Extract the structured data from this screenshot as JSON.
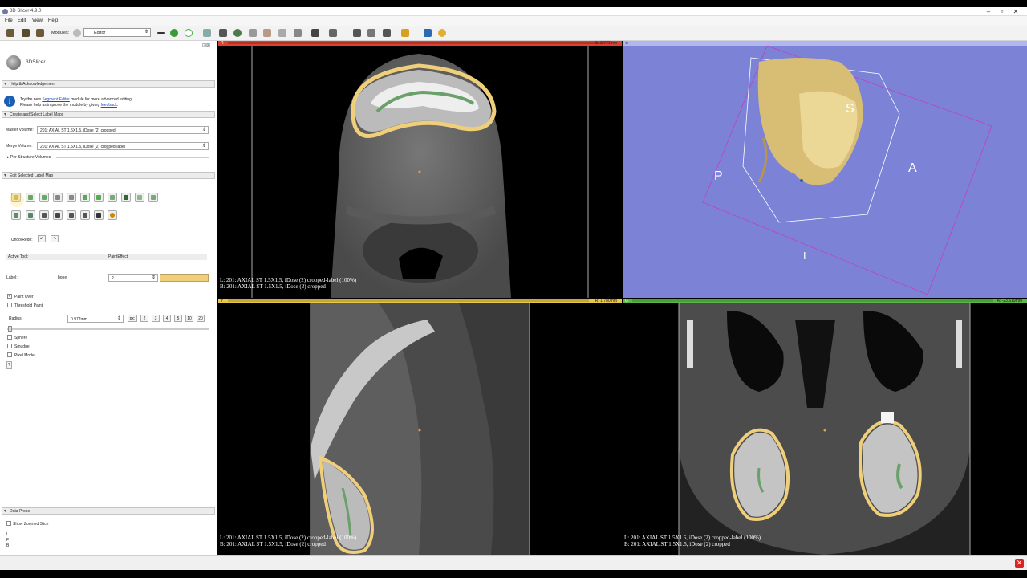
{
  "window": {
    "title": "3D Slicer 4.9.0"
  },
  "menu": [
    "File",
    "Edit",
    "View",
    "Help"
  ],
  "toolbar": {
    "modules_label": "Modules:",
    "module_selected": "Editor"
  },
  "logo": {
    "text": "3DSlicer"
  },
  "sections": {
    "help": "Help & Acknowledgement",
    "create_select": "Create and Select Label Maps",
    "edit_selected": "Edit Selected Label Map",
    "data_probe": "Data Probe"
  },
  "info": {
    "line1_pre": "Try the new ",
    "line1_link": "Segment Editor",
    "line1_post": " module for more advanced editing!",
    "line2_pre": "Please help us improve the module by giving ",
    "line2_link": "feedback",
    "line2_post": "."
  },
  "master_volume": {
    "label": "Master Volume:",
    "value": "201: AXIAL ST 1.5X1.5, iDose (2) cropped"
  },
  "merge_volume": {
    "label": "Merge Volume:",
    "value": "201: AXIAL ST 1.5X1.5, iDose (2) cropped-label"
  },
  "per_structure": "Per-Structure Volumes",
  "undo_redo": "Undo/Redo:",
  "active_tool": {
    "label": "Active Tool:",
    "value": "PaintEffect"
  },
  "label_field": {
    "label": "Label:",
    "name": "bone",
    "value": "2",
    "color": "#f0cf7a"
  },
  "options": {
    "paint_over": "Paint Over",
    "threshold_paint": "Threshold Paint",
    "radius_label": "Radius:",
    "radius_value": "0.977mm",
    "radius_units": [
      "px:",
      "2",
      "3",
      "4",
      "5",
      "10",
      "20"
    ],
    "sphere": "Sphere",
    "smudge": "Smudge",
    "pixel_mode": "Pixel Mode"
  },
  "show_zoomed": "Show Zoomed Slice",
  "probe_lines": [
    "L",
    "F",
    "B"
  ],
  "views": {
    "red": {
      "letter": "R",
      "offset": "S: 2.723mm",
      "color": "#e04030",
      "line1": "L: 201: AXIAL ST 1.5X1.5, iDose (2) cropped-label (100%)",
      "line2": "B: 201: AXIAL ST 1.5X1.5, iDose (2) cropped"
    },
    "yellow": {
      "letter": "Y",
      "offset": "R: 1.780mm",
      "color": "#e8c648",
      "line1": "L: 201: AXIAL ST 1.5X1.5, iDose (2) cropped-label (100%)",
      "line2": "B: 201: AXIAL ST 1.5X1.5, iDose (2) cropped"
    },
    "green": {
      "letter": "G",
      "offset": "A: -23.619mm",
      "color": "#5cb848",
      "line1": "L: 201: AXIAL ST 1.5X1.5, iDose (2) cropped-label (100%)",
      "line2": "B: 201: AXIAL ST 1.5X1.5, iDose (2) cropped"
    },
    "three_d": {
      "labels": {
        "S": "S",
        "P": "P",
        "A": "A",
        "I": "I"
      },
      "bg": "#7c83d6"
    }
  },
  "colors": {
    "segmentation_outline": "#f0cf7a",
    "segmentation_inner": "#6aa06a"
  }
}
